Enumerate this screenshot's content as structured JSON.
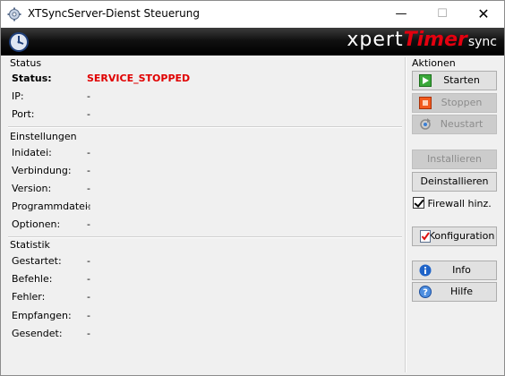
{
  "window": {
    "title": "XTSyncServer-Dienst Steuerung",
    "app_icon": "gear-icon",
    "min_glyph": "—",
    "max_glyph": "☐",
    "close_glyph": "✕"
  },
  "banner": {
    "logo_part1": "xpert",
    "logo_part2": "Timer",
    "logo_part3": "sync",
    "clock_icon": "clock-icon"
  },
  "status": {
    "heading": "Status",
    "rows": [
      {
        "label": "Status:",
        "value": "SERVICE_STOPPED"
      },
      {
        "label": "IP:",
        "value": "-"
      },
      {
        "label": "Port:",
        "value": "-"
      }
    ]
  },
  "settings": {
    "heading": "Einstellungen",
    "rows": [
      {
        "label": "Inidatei:",
        "value": "-"
      },
      {
        "label": "Verbindung:",
        "value": "-"
      },
      {
        "label": "Version:",
        "value": "-"
      },
      {
        "label": "Programmdatei:",
        "value": "-"
      },
      {
        "label": "Optionen:",
        "value": "-"
      }
    ]
  },
  "stats": {
    "heading": "Statistik",
    "rows": [
      {
        "label": "Gestartet:",
        "value": "-"
      },
      {
        "label": "Befehle:",
        "value": "-"
      },
      {
        "label": "Fehler:",
        "value": "-"
      },
      {
        "label": "Empfangen:",
        "value": "-"
      },
      {
        "label": "Gesendet:",
        "value": "-"
      }
    ]
  },
  "actions": {
    "heading": "Aktionen",
    "start": "Starten",
    "stop": "Stoppen",
    "restart": "Neustart",
    "install": "Installieren",
    "uninstall": "Deinstallieren",
    "firewall": "Firewall hinz.",
    "config": "Konfiguration",
    "info": "Info",
    "help": "Hilfe"
  },
  "colors": {
    "status_stopped": "#e00000",
    "banner_bg": "#000000",
    "logo_accent": "#e3000f"
  }
}
